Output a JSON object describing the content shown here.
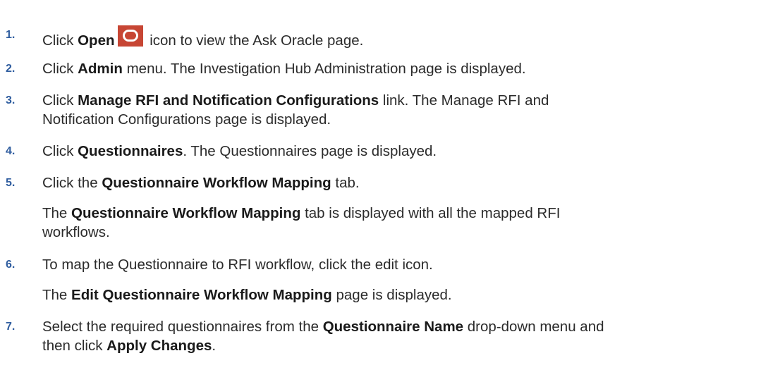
{
  "steps": [
    {
      "num": "1.",
      "pre": "Click ",
      "b1": "Open",
      "post": " icon to view the Ask Oracle page.",
      "icon": "oracle-open-icon"
    },
    {
      "num": "2.",
      "pre": "Click ",
      "b1": "Admin",
      "post": " menu. The Investigation Hub Administration page is displayed."
    },
    {
      "num": "3.",
      "pre": "Click ",
      "b1": "Manage RFI and Notification Configurations",
      "post": " link. The Manage RFI and",
      "line2": "Notification Configurations page is displayed."
    },
    {
      "num": "4.",
      "pre": "Click ",
      "b1": "Questionnaires",
      "post": ". The Questionnaires page is displayed."
    },
    {
      "num": "5.",
      "pre": "Click the ",
      "b1": "Questionnaire Workflow Mapping",
      "post": " tab.",
      "sub_pre": "The ",
      "sub_b": "Questionnaire Workflow Mapping",
      "sub_post": " tab is displayed with all the mapped RFI",
      "sub_line2": "workflows."
    },
    {
      "num": "6.",
      "text": "To map the Questionnaire to RFI workflow, click the edit icon.",
      "sub_pre": "The ",
      "sub_b": "Edit Questionnaire Workflow Mapping",
      "sub_post": " page is displayed."
    },
    {
      "num": "7.",
      "pre": "Select the required questionnaires from the ",
      "b1": "Questionnaire Name",
      "post": " drop-down menu and",
      "line2_pre": "then click ",
      "line2_b": "Apply Changes",
      "line2_post": "."
    }
  ],
  "colors": {
    "number": "#2f5d9f",
    "icon_bg": "#c74634"
  }
}
